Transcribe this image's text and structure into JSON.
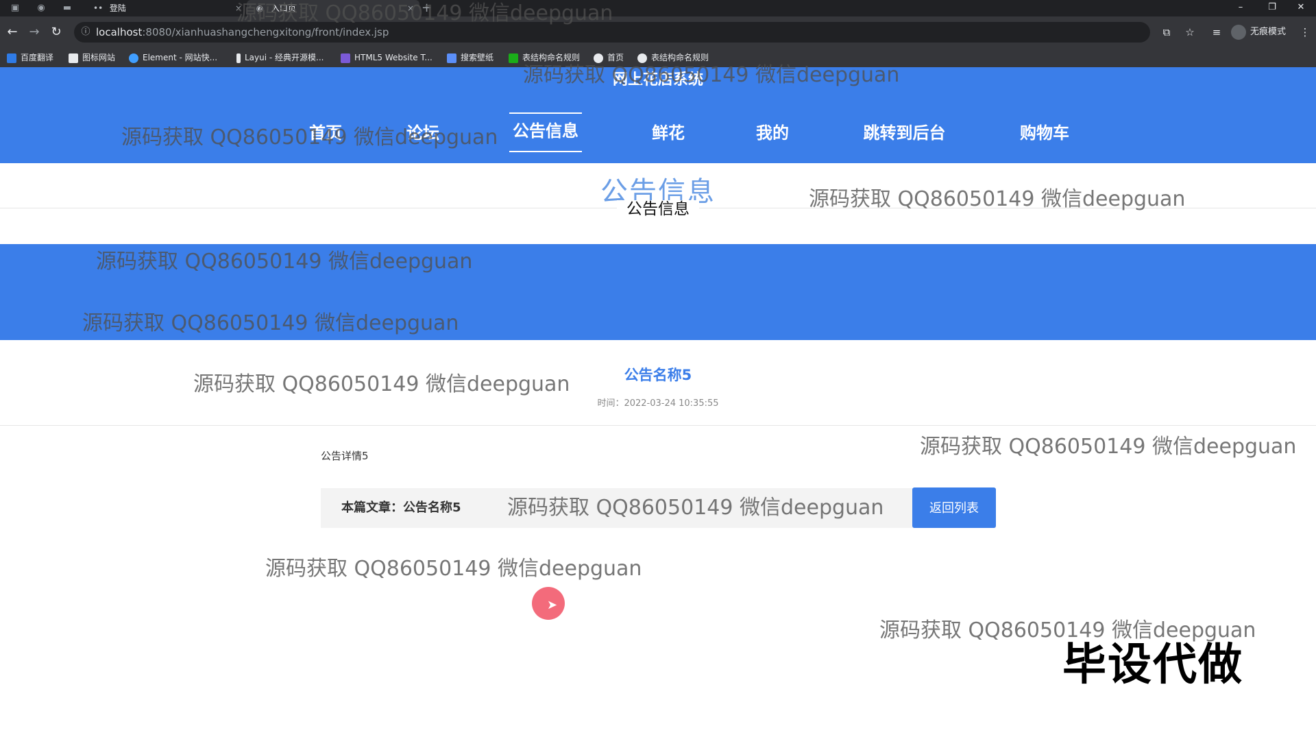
{
  "browser": {
    "tabs": [
      {
        "label": "登陆"
      },
      {
        "label": "入口页"
      }
    ],
    "url_host": "localhost",
    "url_rest": ":8080/xianhuashangchengxitong/front/index.jsp",
    "incognito_label": "无痕模式",
    "bookmarks": [
      {
        "label": "百度翻译",
        "color": "#2f7be6"
      },
      {
        "label": "图标网站",
        "color": "#e8eaed"
      },
      {
        "label": "Element - 网站快...",
        "color": "#409eff"
      },
      {
        "label": "Layui - 经典开源模...",
        "color": "#e8eaed"
      },
      {
        "label": "HTML5 Website T...",
        "color": "#7b5ad6"
      },
      {
        "label": "搜索壁纸",
        "color": "#5b8ff9"
      },
      {
        "label": "表结构命名规则",
        "color": "#1aad19"
      },
      {
        "label": "首页",
        "color": "#e8eaed"
      },
      {
        "label": "表结构命名规则",
        "color": "#e8eaed"
      }
    ]
  },
  "site": {
    "title": "网上花店系统",
    "nav": [
      {
        "label": "首页"
      },
      {
        "label": "论坛"
      },
      {
        "label": "公告信息",
        "active": true
      },
      {
        "label": "鲜花"
      },
      {
        "label": "我的"
      },
      {
        "label": "跳转到后台"
      },
      {
        "label": "购物车"
      }
    ],
    "accent": "#3b7ee9"
  },
  "section": {
    "title_large": "公告信息",
    "title_small": "公告信息"
  },
  "notice": {
    "title": "公告名称5",
    "time": "时间：2022-03-24 10:35:55",
    "body": "公告详情5",
    "article_label": "本篇文章：公告名称5",
    "back_button": "返回列表"
  },
  "overlay": {
    "watermark": "源码获取 QQ86050149 微信deepguan",
    "stamp": "毕设代做"
  }
}
